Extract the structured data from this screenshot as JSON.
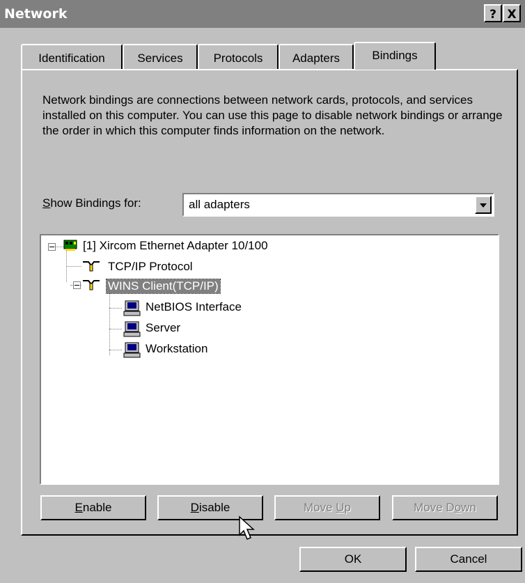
{
  "window": {
    "title": "Network",
    "help_button": "?",
    "close_button": "X"
  },
  "tabs": [
    {
      "label": "Identification",
      "active": false
    },
    {
      "label": "Services",
      "active": false
    },
    {
      "label": "Protocols",
      "active": false
    },
    {
      "label": "Adapters",
      "active": false
    },
    {
      "label": "Bindings",
      "active": true
    }
  ],
  "bindings": {
    "description": "Network bindings are connections between network cards, protocols, and services installed on this computer.  You can use this page to disable network bindings or arrange the order in which this computer finds information on the network.",
    "show_label_prefix": "S",
    "show_label_rest": "how Bindings for:",
    "show_value": "all adapters",
    "tree": [
      {
        "label": "[1] Xircom Ethernet Adapter 10/100",
        "icon": "network-card-icon",
        "level": 0,
        "expanded": true
      },
      {
        "label": "TCP/IP Protocol",
        "icon": "protocol-cable-icon",
        "level": 1
      },
      {
        "label": "WINS Client(TCP/IP)",
        "icon": "protocol-cable-icon",
        "level": 1,
        "expanded": true,
        "selected": true
      },
      {
        "label": "NetBIOS Interface",
        "icon": "computer-service-icon",
        "level": 2
      },
      {
        "label": "Server",
        "icon": "computer-service-icon",
        "level": 2
      },
      {
        "label": "Workstation",
        "icon": "computer-service-icon",
        "level": 2
      }
    ]
  },
  "buttons": {
    "enable": {
      "mnemonic": "E",
      "rest": "nable"
    },
    "disable": {
      "mnemonic": "D",
      "rest": "isable"
    },
    "move_up": {
      "pre": "Move ",
      "mnemonic": "U",
      "rest": "p"
    },
    "move_down": {
      "pre": "Move D",
      "mnemonic": "o",
      "rest": "wn"
    },
    "ok": "OK",
    "cancel": "Cancel"
  },
  "colors": {
    "face": "#c0c0c0",
    "title_inactive": "#808080",
    "selection": "#808080"
  }
}
